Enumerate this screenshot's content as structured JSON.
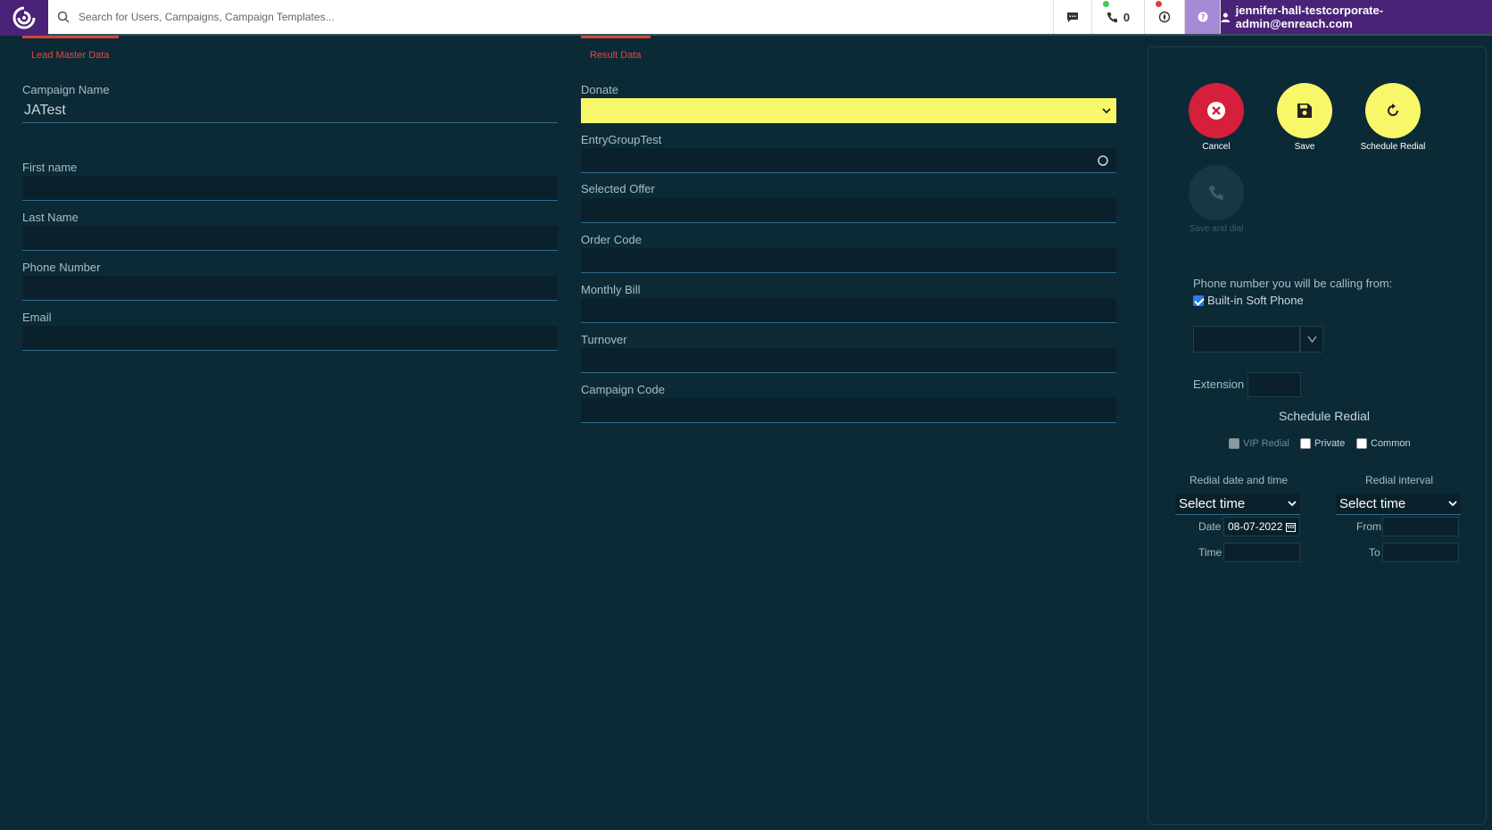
{
  "topbar": {
    "search_placeholder": "Search for Users, Campaigns, Campaign Templates...",
    "calls_count": "0",
    "user_email": "jennifer-hall-testcorporate-admin@enreach.com"
  },
  "sections": {
    "lead_master": "Lead Master Data",
    "result": "Result Data"
  },
  "lead_fields": {
    "campaign_name_label": "Campaign Name",
    "campaign_name_value": "JATest",
    "first_name_label": "First name",
    "last_name_label": "Last Name",
    "phone_label": "Phone Number",
    "email_label": "Email"
  },
  "result_fields": {
    "donate_label": "Donate",
    "entry_group_label": "EntryGroupTest",
    "selected_offer_label": "Selected Offer",
    "order_code_label": "Order Code",
    "monthly_bill_label": "Monthly Bill",
    "turnover_label": "Turnover",
    "campaign_code_label": "Campaign Code"
  },
  "actions": {
    "cancel": "Cancel",
    "save": "Save",
    "schedule_redial": "Schedule Redial",
    "save_and_dial": "Save and dial"
  },
  "calling": {
    "from_label": "Phone number you will be calling from:",
    "soft_phone_label": "Built-in Soft Phone",
    "soft_phone_checked": true,
    "extension_label": "Extension"
  },
  "redial": {
    "title": "Schedule Redial",
    "vip_label": "VIP Redial",
    "private_label": "Private",
    "common_label": "Common",
    "date_time_header": "Redial date and time",
    "interval_header": "Redial interval",
    "select_time_1": "Select time",
    "select_time_2": "Select time",
    "date_label": "Date",
    "date_value": "08-07-2022",
    "time_label": "Time",
    "from_label": "From",
    "to_label": "To"
  },
  "colors": {
    "background": "#0c2a36",
    "brand_purple": "#4a2277",
    "cancel_red": "#d61f3a",
    "action_yellow": "#f7f769",
    "section_red": "#e8453c"
  }
}
